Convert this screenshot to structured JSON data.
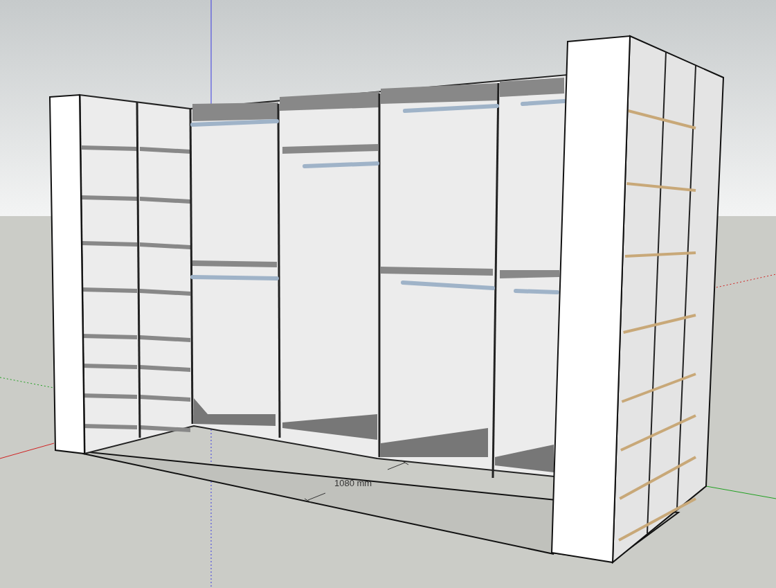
{
  "viewport": {
    "dimension": {
      "label": "1080 mm"
    }
  }
}
